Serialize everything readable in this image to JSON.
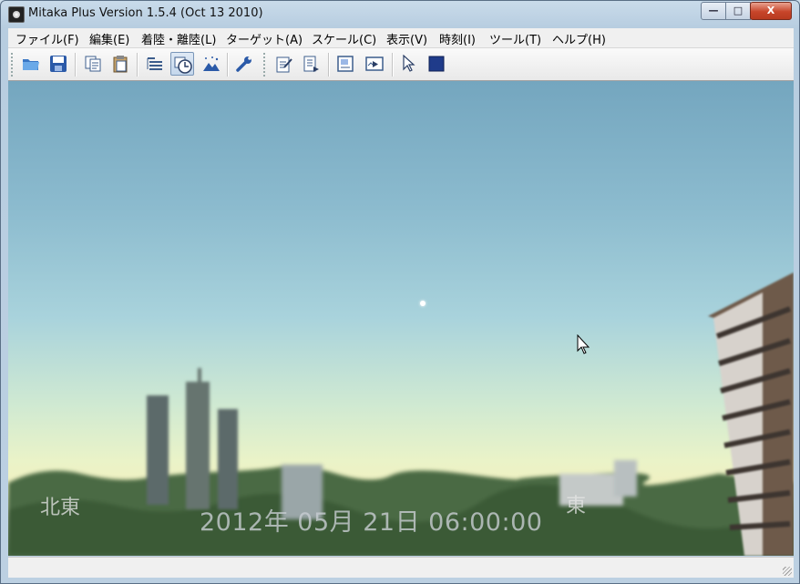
{
  "window": {
    "title": "Mitaka Plus Version 1.5.4 (Oct 13 2010)"
  },
  "window_controls": {
    "minimize": "—",
    "maximize": "□",
    "close": "X"
  },
  "menubar": [
    {
      "label": "ファイル(F)"
    },
    {
      "label": "編集(E)"
    },
    {
      "label": "着陸・離陸(L)"
    },
    {
      "label": "ターゲット(A)"
    },
    {
      "label": "スケール(C)"
    },
    {
      "label": "表示(V)"
    },
    {
      "label": "時刻(I)"
    },
    {
      "label": "ツール(T)"
    },
    {
      "label": "ヘルプ(H)"
    }
  ],
  "toolbar": {
    "buttons": [
      {
        "icon": "open-folder-icon"
      },
      {
        "icon": "save-disk-icon"
      },
      {
        "icon": "copy-icon"
      },
      {
        "icon": "paste-icon"
      },
      {
        "icon": "layers-icon"
      },
      {
        "icon": "time-clock-icon",
        "active": true
      },
      {
        "icon": "landscape-icon"
      },
      {
        "icon": "wrench-icon"
      },
      {
        "icon": "edit-note-icon"
      },
      {
        "icon": "script-icon"
      },
      {
        "icon": "image-panel-icon"
      },
      {
        "icon": "movie-play-icon"
      },
      {
        "icon": "pointer-icon"
      },
      {
        "icon": "stop-square-icon"
      }
    ]
  },
  "viewport": {
    "direction_left": "北東",
    "direction_right": "東",
    "datetime": "2012年 05月 21日 06:00:00"
  },
  "colors": {
    "sky_top": "#74a6bf",
    "sky_horizon": "#f2f0c0",
    "accent_active": "#7a96b8"
  }
}
